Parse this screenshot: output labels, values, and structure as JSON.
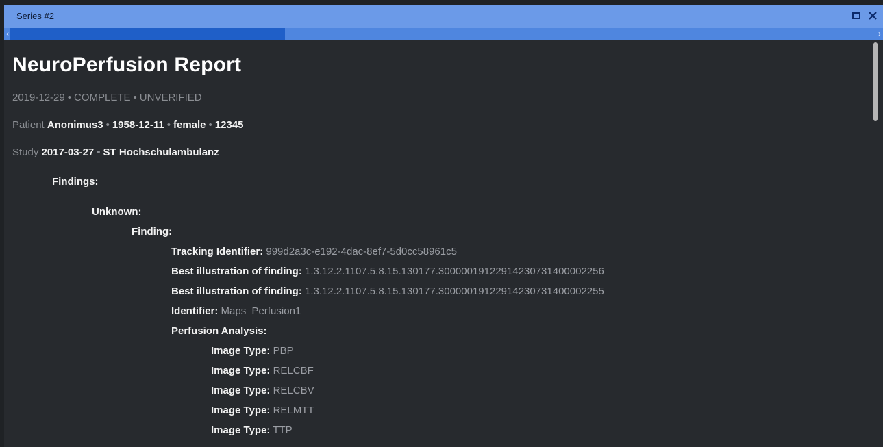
{
  "window": {
    "title": "Series #2",
    "maximize_icon": "maximize-icon",
    "close_icon": "close-icon"
  },
  "report": {
    "title": "NeuroPerfusion Report",
    "meta": {
      "date": "2019-12-29",
      "status": "COMPLETE",
      "verification": "UNVERIFIED"
    },
    "patient": {
      "label": "Patient",
      "name": "Anonimus3",
      "birthdate": "1958-12-11",
      "sex": "female",
      "id": "12345"
    },
    "study": {
      "label": "Study",
      "date": "2017-03-27",
      "location": "ST Hochschulambulanz"
    },
    "findings_heading": "Findings:",
    "unknown_heading": "Unknown:",
    "finding_heading": "Finding:",
    "tracking": {
      "label": "Tracking Identifier:",
      "value": "999d2a3c-e192-4dac-8ef7-5d0cc58961c5"
    },
    "illustrations": [
      {
        "label": "Best illustration of finding:",
        "value": "1.3.12.2.1107.5.8.15.130177.30000019122914230731400002256"
      },
      {
        "label": "Best illustration of finding:",
        "value": "1.3.12.2.1107.5.8.15.130177.30000019122914230731400002255"
      }
    ],
    "identifier": {
      "label": "Identifier:",
      "value": "Maps_Perfusion1"
    },
    "perfusion_heading": "Perfusion Analysis:",
    "image_types": [
      {
        "label": "Image Type:",
        "value": "PBP"
      },
      {
        "label": "Image Type:",
        "value": "RELCBF"
      },
      {
        "label": "Image Type:",
        "value": "RELCBV"
      },
      {
        "label": "Image Type:",
        "value": "RELMTT"
      },
      {
        "label": "Image Type:",
        "value": "TTP"
      }
    ]
  }
}
